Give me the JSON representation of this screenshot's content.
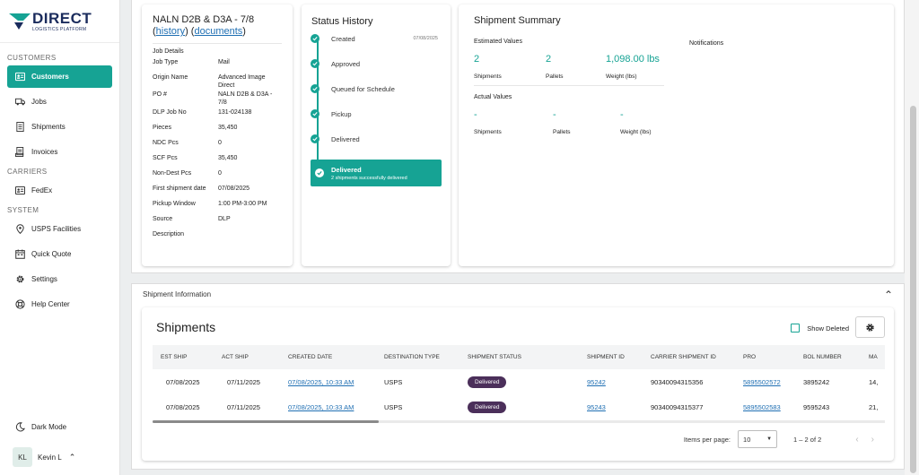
{
  "brand": {
    "name": "DIRECT",
    "subtitle": "LOGISTICS PLATFORM",
    "accent": "#16a394",
    "navy": "#1a2b5c"
  },
  "sidebar": {
    "sections": [
      {
        "header": "CUSTOMERS",
        "items": [
          {
            "label": "Customers",
            "icon": "customers-icon",
            "active": true
          },
          {
            "label": "Jobs",
            "icon": "truck-icon"
          },
          {
            "label": "Shipments",
            "icon": "document-icon"
          },
          {
            "label": "Invoices",
            "icon": "invoice-icon"
          }
        ]
      },
      {
        "header": "CARRIERS",
        "items": [
          {
            "label": "FedEx",
            "icon": "id-card-icon"
          }
        ]
      },
      {
        "header": "SYSTEM",
        "items": [
          {
            "label": "USPS Facilities",
            "icon": "location-pin-icon"
          },
          {
            "label": "Quick Quote",
            "icon": "calendar-icon"
          },
          {
            "label": "Settings",
            "icon": "gear-icon"
          },
          {
            "label": "Help Center",
            "icon": "lifebuoy-icon"
          }
        ]
      }
    ],
    "dark_mode_label": "Dark Mode",
    "user": {
      "initials": "KL",
      "name": "Kevin L"
    }
  },
  "job": {
    "title": "NALN D2B & D3A - 7/8",
    "history_link": "history",
    "documents_link": "documents",
    "section_title": "Job Details",
    "details": [
      {
        "key": "Job Type",
        "value": "Mail"
      },
      {
        "key": "Origin Name",
        "value": "Advanced Image Direct"
      },
      {
        "key": "PO #",
        "value": "NALN D2B & D3A - 7/8"
      },
      {
        "key": "DLP Job No",
        "value": "131-024138"
      },
      {
        "key": "Pieces",
        "value": "35,450"
      },
      {
        "key": "NDC Pcs",
        "value": "0"
      },
      {
        "key": "SCF Pcs",
        "value": "35,450"
      },
      {
        "key": "Non-Dest Pcs",
        "value": "0"
      },
      {
        "key": "First shipment date",
        "value": "07/08/2025"
      },
      {
        "key": "Pickup Window",
        "value": "1:00 PM-3:00 PM"
      },
      {
        "key": "Source",
        "value": "DLP"
      },
      {
        "key": "Description",
        "value": ""
      }
    ]
  },
  "status_history": {
    "title": "Status History",
    "steps": [
      {
        "label": "Created",
        "date": "07/08/2025"
      },
      {
        "label": "Approved",
        "date": ""
      },
      {
        "label": "Queued for Schedule",
        "date": ""
      },
      {
        "label": "Pickup",
        "date": ""
      },
      {
        "label": "Delivered",
        "date": ""
      }
    ],
    "final": {
      "label": "Delivered",
      "sub": "2 shipments successfully delivered"
    }
  },
  "summary": {
    "title": "Shipment Summary",
    "estimated_label": "Estimated Values",
    "notifications_label": "Notifications",
    "estimated": [
      {
        "value": "2",
        "label": "Shipments"
      },
      {
        "value": "2",
        "label": "Pallets"
      },
      {
        "value": "1,098.00 lbs",
        "label": "Weight (lbs)"
      }
    ],
    "actual_label": "Actual Values",
    "actual": [
      {
        "value": "-",
        "label": "Shipments"
      },
      {
        "value": "-",
        "label": "Pallets"
      },
      {
        "value": "-",
        "label": "Weight (lbs)"
      }
    ]
  },
  "shipment_info": {
    "title": "Shipment Information",
    "card_title": "Shipments",
    "show_deleted_label": "Show Deleted",
    "columns": [
      "EST SHIP",
      "ACT SHIP",
      "CREATED DATE",
      "DESTINATION TYPE",
      "SHIPMENT STATUS",
      "SHIPMENT ID",
      "CARRIER SHIPMENT ID",
      "PRO",
      "BOL NUMBER",
      "MA"
    ],
    "rows": [
      {
        "est_ship": "07/08/2025",
        "act_ship": "07/11/2025",
        "created": "07/08/2025, 10:33 AM",
        "dest": "USPS",
        "status": "Delivered",
        "shipment_id": "95242",
        "carrier_id": "90340094315356",
        "pro": "5895502572",
        "bol": "3895242",
        "ma": "14,"
      },
      {
        "est_ship": "07/08/2025",
        "act_ship": "07/11/2025",
        "created": "07/08/2025, 10:33 AM",
        "dest": "USPS",
        "status": "Delivered",
        "shipment_id": "95243",
        "carrier_id": "90340094315377",
        "pro": "5895502583",
        "bol": "9595243",
        "ma": "21,"
      }
    ],
    "pagination": {
      "items_per_page_label": "Items per page:",
      "items_per_page": "10",
      "range": "1 – 2 of 2"
    }
  }
}
